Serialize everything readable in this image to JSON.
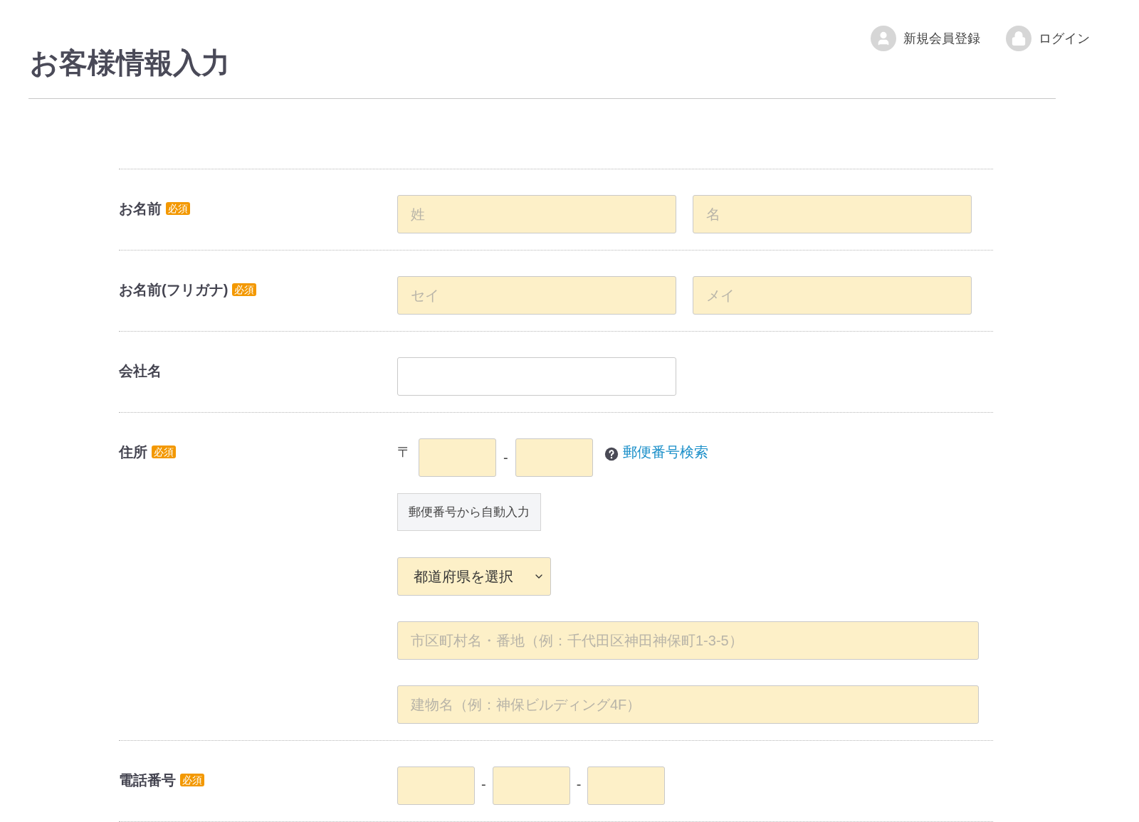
{
  "header": {
    "title": "お客様情報入力",
    "links": [
      {
        "kind": "register",
        "label": "新規会員登録"
      },
      {
        "kind": "login",
        "label": "ログイン"
      }
    ]
  },
  "form": {
    "rows": [
      {
        "kind": "pair",
        "label": "お名前",
        "badge": "必須",
        "fields": [
          {
            "placeholder": "姓"
          },
          {
            "placeholder": "名"
          }
        ]
      },
      {
        "kind": "pair",
        "label": "お名前(フリガナ)",
        "badge": "必須",
        "fields": [
          {
            "placeholder": "セイ"
          },
          {
            "placeholder": "メイ"
          }
        ]
      },
      {
        "kind": "single",
        "label": "会社名"
      },
      {
        "kind": "address",
        "label": "住所",
        "badge": "必須",
        "postal_mark": "〒",
        "separator": "-",
        "lookup_link": "郵便番号検索",
        "autofill_button": "郵便番号から自動入力",
        "prefecture_select": "都道府県を選択",
        "fields": [
          {
            "placeholder": "市区町村名・番地（例：千代田区神田神保町1-3-5）"
          },
          {
            "placeholder": "建物名（例：神保ビルディング4F）"
          }
        ]
      },
      {
        "kind": "phone",
        "label": "電話番号",
        "badge": "必須",
        "separators": [
          "-",
          "-"
        ]
      }
    ]
  }
}
